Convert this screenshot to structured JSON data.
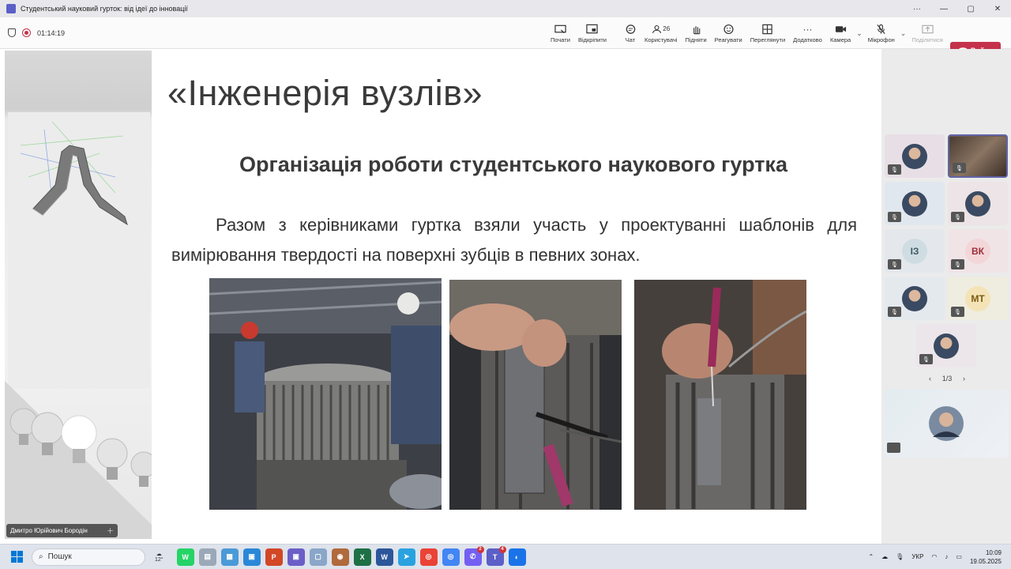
{
  "window": {
    "title": "Студентський науковий гурток: від ідеї до інновації",
    "min": "—",
    "max": "▢",
    "close": "✕",
    "more": "···"
  },
  "toolbar": {
    "timer": "01:14:19",
    "buttons": [
      {
        "id": "start",
        "label": "Почати"
      },
      {
        "id": "unpin",
        "label": "Відкріпити"
      },
      {
        "id": "chat",
        "label": "Чат"
      },
      {
        "id": "people",
        "label": "Користувачі",
        "count": "26"
      },
      {
        "id": "raise",
        "label": "Підняти"
      },
      {
        "id": "react",
        "label": "Реагувати"
      },
      {
        "id": "view",
        "label": "Переглянути"
      },
      {
        "id": "more",
        "label": "Додатково"
      },
      {
        "id": "camera",
        "label": "Камера"
      },
      {
        "id": "mic",
        "label": "Мікрофон"
      },
      {
        "id": "share",
        "label": "Поділитися"
      }
    ],
    "leave": "Вийти"
  },
  "slide": {
    "title": "«Інженерія вузлів»",
    "subtitle": "Організація роботи студентського наукового гуртка",
    "body": "Разом з керівниками гуртка взяли участь у проектуванні  шаблонів для вимірювання твердості на поверхні зубців в певних зонах."
  },
  "presenter": {
    "name": "Дмитро Юрійович Бородін"
  },
  "participants": [
    {
      "initials": "",
      "bg": "#e8dfe6",
      "avatar": "photo"
    },
    {
      "initials": "",
      "bg": "#6d5a4c",
      "avatar": "video",
      "active": true
    },
    {
      "initials": "",
      "bg": "#e1e7ee",
      "avatar": "photo"
    },
    {
      "initials": "",
      "bg": "#ece4e6",
      "avatar": "photo"
    },
    {
      "initials": "ІЗ",
      "bg": "#e4e8ec",
      "avatar_bg": "#cfdde3",
      "color": "#3d5a66"
    },
    {
      "initials": "ВК",
      "bg": "#f0e4e6",
      "avatar_bg": "#f3d6d8",
      "color": "#9c2f3c"
    },
    {
      "initials": "",
      "bg": "#e4e9ee",
      "avatar": "photo"
    },
    {
      "initials": "МТ",
      "bg": "#efece0",
      "avatar_bg": "#f3e3b6",
      "color": "#7a5a12"
    },
    {
      "initials": "",
      "bg": "#ece6ea",
      "avatar": "photo"
    }
  ],
  "pager": {
    "prev": "‹",
    "label": "1/3",
    "next": "›"
  },
  "taskbar": {
    "search": "Пошук",
    "weather": "12°",
    "lang": "УКР",
    "time": "10:09",
    "date": "19.05.2025"
  },
  "colors": {
    "accent": "#6264a7",
    "leave": "#c4314b"
  }
}
